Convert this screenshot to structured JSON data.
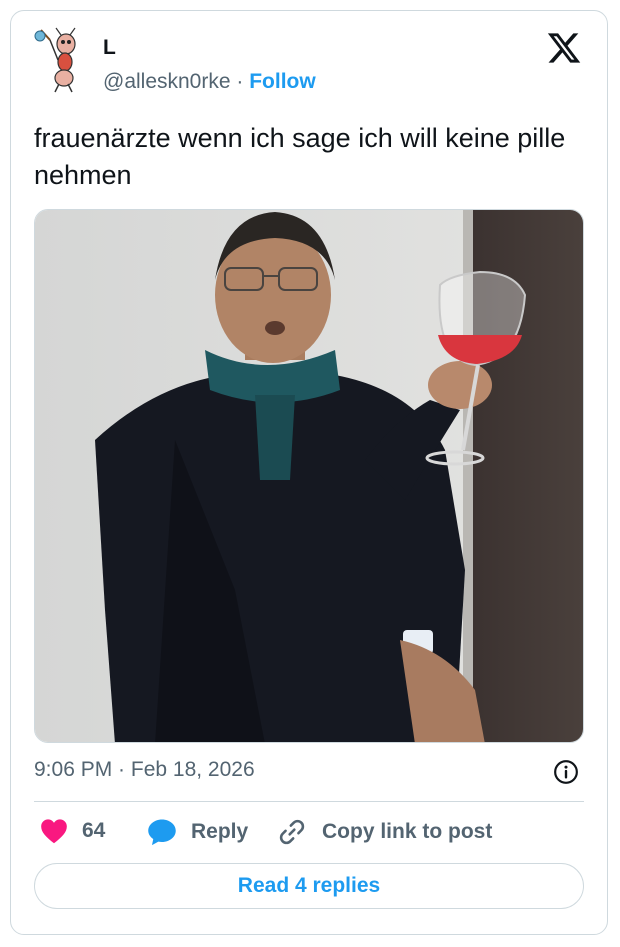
{
  "author": {
    "display_name": "L",
    "handle": "@alleskn0rke",
    "separator": "·",
    "follow_label": "Follow"
  },
  "tweet": {
    "text": "frauenärzte wenn ich sage ich will keine pille nehmen"
  },
  "meta": {
    "timestamp": "9:06 PM · Feb 18, 2026"
  },
  "actions": {
    "like_count": "64",
    "reply_label": "Reply",
    "copy_link_label": "Copy link to post"
  },
  "replies_button": {
    "label": "Read 4 replies"
  },
  "icons": {
    "avatar": "cartoon-ant-avatar",
    "brand": "x-logo-icon",
    "info": "info-icon",
    "like": "heart-icon",
    "reply": "speech-bubble-icon",
    "copy": "link-icon"
  },
  "colors": {
    "accent": "#1d9bf0",
    "like": "#f91880",
    "muted": "#536471",
    "border": "#cfd9de",
    "text": "#0f1419"
  }
}
